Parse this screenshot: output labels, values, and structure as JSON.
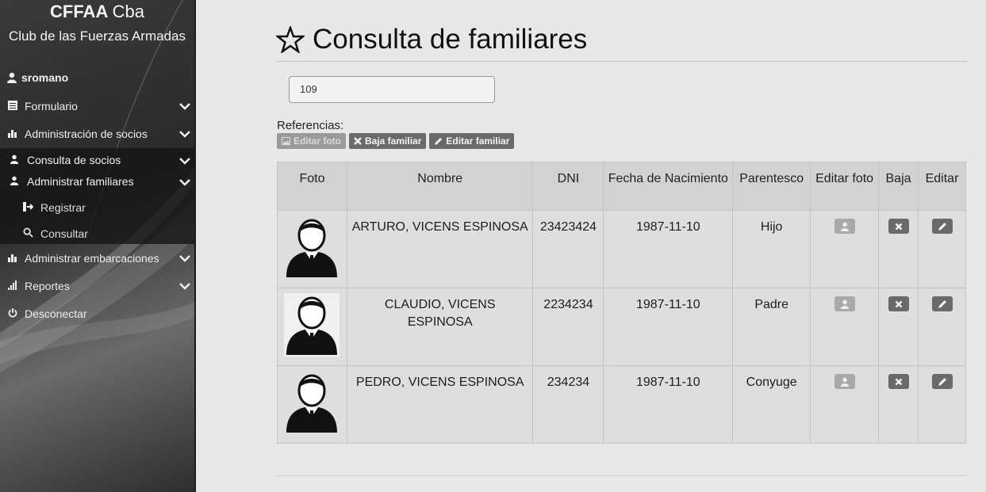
{
  "sidebar": {
    "brand_bold": "CFFAA",
    "brand_light": "Cba",
    "subtitle": "Club de las Fuerzas Armadas",
    "username": "sromano",
    "menu": {
      "formulario": "Formulario",
      "admin_socios": "Administración de socios",
      "consulta_socios": "Consulta de socios",
      "admin_familiares": "Administrar familiares",
      "registrar": "Registrar",
      "consultar": "Consultar",
      "admin_embarcaciones": "Administrar embarcaciones",
      "reportes": "Reportes",
      "desconectar": "Desconectar"
    }
  },
  "page": {
    "title": "Consulta de familiares",
    "search_value": "109",
    "refs_label": "Referencias:",
    "refs": {
      "editar_foto": "Editar foto",
      "baja_familiar": "Baja familiar",
      "editar_familiar": "Editar familiar"
    }
  },
  "table": {
    "headers": {
      "foto": "Foto",
      "nombre": "Nombre",
      "dni": "DNI",
      "fecha": "Fecha de Nacimiento",
      "parentesco": "Parentesco",
      "editar_foto": "Editar foto",
      "baja": "Baja",
      "editar": "Editar"
    },
    "rows": [
      {
        "nombre": "ARTURO, VICENS ESPINOSA",
        "dni": "23423424",
        "fecha": "1987-11-10",
        "parentesco": "Hijo"
      },
      {
        "nombre": "CLAUDIO, VICENS ESPINOSA",
        "dni": "2234234",
        "fecha": "1987-11-10",
        "parentesco": "Padre"
      },
      {
        "nombre": "PEDRO, VICENS ESPINOSA",
        "dni": "234234",
        "fecha": "1987-11-10",
        "parentesco": "Conyuge"
      }
    ]
  },
  "icons": {
    "title": "star-outline-icon",
    "user": "user-icon",
    "photo": "picture-icon",
    "delete": "x-icon",
    "edit": "pencil-icon"
  }
}
